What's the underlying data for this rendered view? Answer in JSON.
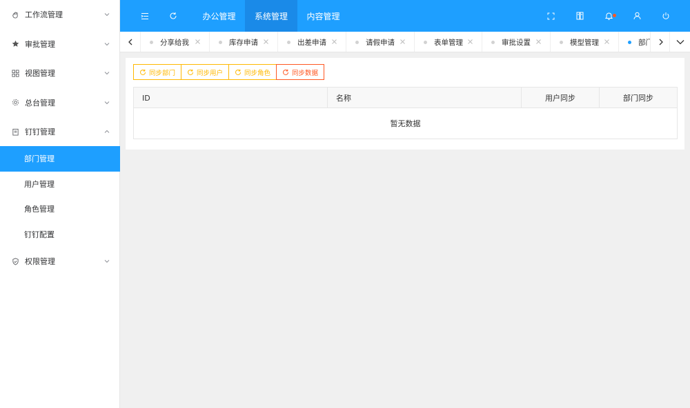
{
  "sidebar": {
    "menus": [
      {
        "label": "工作流管理",
        "icon": "hand-icon",
        "expanded": false
      },
      {
        "label": "审批管理",
        "icon": "star-icon",
        "expanded": false
      },
      {
        "label": "视图管理",
        "icon": "grid-icon",
        "expanded": false
      },
      {
        "label": "总台管理",
        "icon": "gear-icon",
        "expanded": false
      },
      {
        "label": "钉钉管理",
        "icon": "clipboard-icon",
        "expanded": true
      },
      {
        "label": "权限管理",
        "icon": "shield-icon",
        "expanded": false
      }
    ],
    "submenu": [
      {
        "label": "部门管理",
        "active": true
      },
      {
        "label": "用户管理",
        "active": false
      },
      {
        "label": "角色管理",
        "active": false
      },
      {
        "label": "钉钉配置",
        "active": false
      }
    ]
  },
  "topbar": {
    "nav": [
      {
        "label": "办公管理",
        "active": false
      },
      {
        "label": "系统管理",
        "active": true
      },
      {
        "label": "内容管理",
        "active": false
      }
    ],
    "icons": [
      "menu-fold-icon",
      "refresh-icon",
      "fullscreen-icon",
      "notes-icon",
      "bell-icon",
      "user-icon",
      "power-icon"
    ],
    "accent_color": "#1e9fff",
    "badge_color": "#ff5722"
  },
  "tabs": [
    {
      "label": "分享给我",
      "active": false
    },
    {
      "label": "库存申请",
      "active": false
    },
    {
      "label": "出差申请",
      "active": false
    },
    {
      "label": "请假申请",
      "active": false
    },
    {
      "label": "表单管理",
      "active": false
    },
    {
      "label": "审批设置",
      "active": false
    },
    {
      "label": "模型管理",
      "active": false
    },
    {
      "label": "部门管理",
      "active": true
    }
  ],
  "toolbar": {
    "buttons": [
      {
        "label": "同步部门",
        "style": "warm"
      },
      {
        "label": "同步用户",
        "style": "warm"
      },
      {
        "label": "同步角色",
        "style": "warm"
      },
      {
        "label": "同步数据",
        "style": "danger"
      }
    ]
  },
  "table": {
    "columns": [
      "ID",
      "名称",
      "用户同步",
      "部门同步"
    ],
    "empty_text": "暂无数据"
  }
}
